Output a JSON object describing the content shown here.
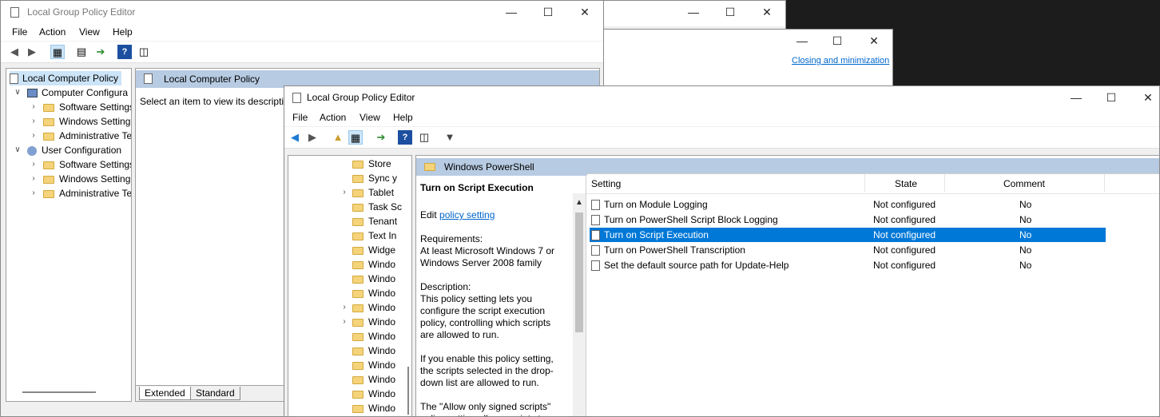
{
  "back_window_1": {
    "title": ""
  },
  "back_window_2": {
    "link": "Closing and minimization"
  },
  "main_window": {
    "title": "Local Group Policy Editor",
    "menu": [
      "File",
      "Action",
      "View",
      "Help"
    ],
    "tree": [
      {
        "label": "Local Computer Policy",
        "level": 0
      },
      {
        "label": "Computer Configura",
        "level": 1
      },
      {
        "label": "Software Settings",
        "level": 2
      },
      {
        "label": "Windows Setting",
        "level": 2
      },
      {
        "label": "Administrative Te",
        "level": 2
      },
      {
        "label": "User Configuration",
        "level": 1
      },
      {
        "label": "Software Settings",
        "level": 2
      },
      {
        "label": "Windows Setting",
        "level": 2
      },
      {
        "label": "Administrative Te",
        "level": 2
      }
    ],
    "header": "Local Computer Policy",
    "description": "Select an item to view its descriptio",
    "tabs": [
      "Extended",
      "Standard"
    ]
  },
  "front_window": {
    "title": "Local Group Policy Editor",
    "menu": [
      "File",
      "Action",
      "View",
      "Help"
    ],
    "tree": [
      "Store",
      "Sync y",
      "Tablet",
      "Task Sc",
      "Tenant",
      "Text In",
      "Widge",
      "Windo",
      "Windo",
      "Windo",
      "Windo",
      "Windo",
      "Windo",
      "Windo",
      "Windo",
      "Windo",
      "Windo",
      "Windo"
    ],
    "folder_header": "Windows PowerShell",
    "desc": {
      "title": "Turn on Script Execution",
      "edit_prefix": "Edit ",
      "edit_link": "policy setting ",
      "requirements_label": "Requirements:",
      "requirements_text": "At least Microsoft Windows 7 or Windows Server 2008 family",
      "description_label": "Description:",
      "description_text": "This policy setting lets you configure the script execution policy, controlling which scripts are allowed to run.",
      "enable_text": "If you enable this policy setting, the scripts selected in the drop-down list are allowed to run.",
      "allow_text": "The \"Allow only signed scripts\" policy setting allows scripts to"
    },
    "columns": {
      "setting": "Setting",
      "state": "State",
      "comment": "Comment"
    },
    "rows": [
      {
        "setting": "Turn on Module Logging",
        "state": "Not configured",
        "comment": "No"
      },
      {
        "setting": "Turn on PowerShell Script Block Logging",
        "state": "Not configured",
        "comment": "No"
      },
      {
        "setting": "Turn on Script Execution",
        "state": "Not configured",
        "comment": "No"
      },
      {
        "setting": "Turn on PowerShell Transcription",
        "state": "Not configured",
        "comment": "No"
      },
      {
        "setting": "Set the default source path for Update-Help",
        "state": "Not configured",
        "comment": "No"
      }
    ]
  },
  "icons": {
    "minimize": "minimize-icon",
    "maximize": "maximize-icon",
    "close": "close-icon"
  }
}
